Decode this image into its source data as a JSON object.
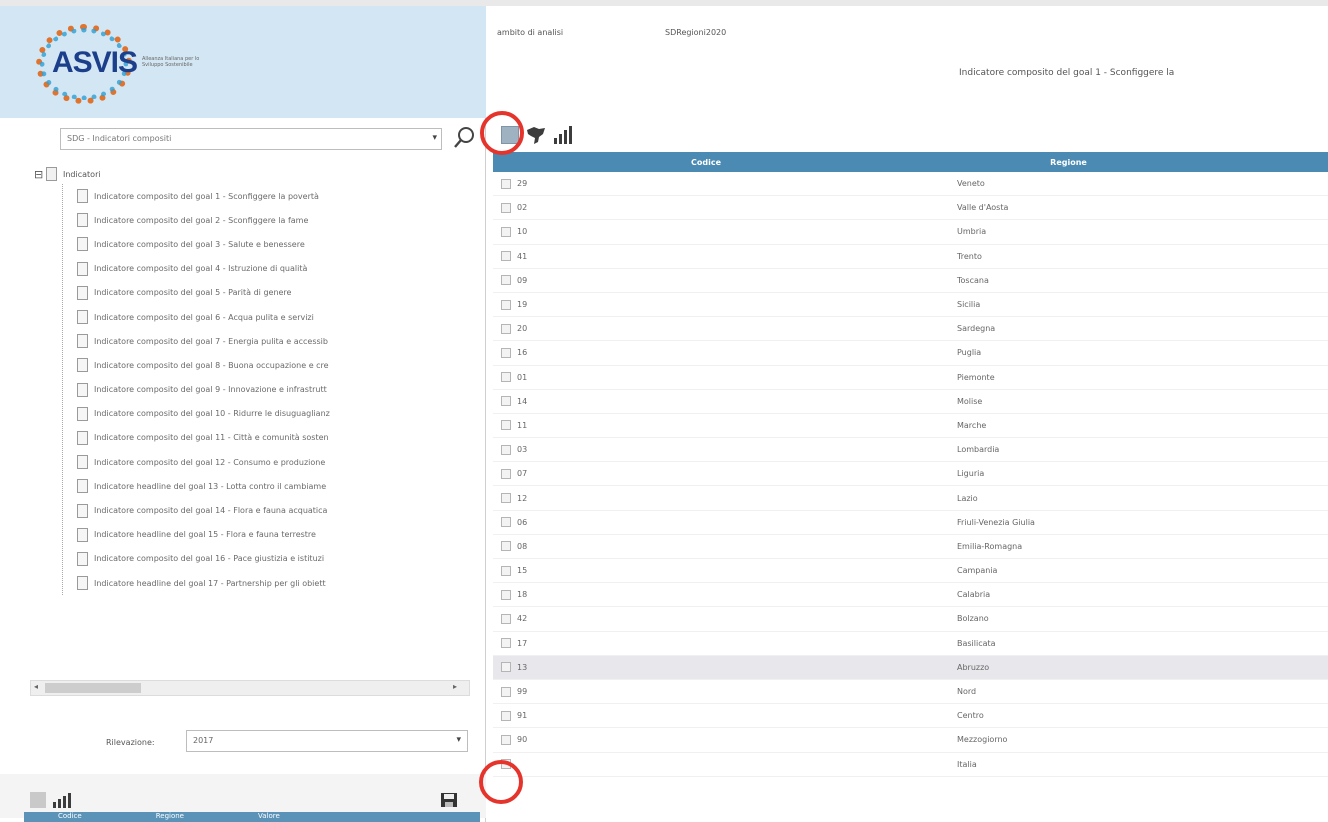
{
  "left": {
    "logo": {
      "text": "ASVIS",
      "subtitle": "Alleanza Italiana per lo Sviluppo Sostenibile"
    },
    "combo": {
      "value": "SDG - Indicatori compositi"
    },
    "tree": {
      "root_label": "Indicatori",
      "items": [
        "Indicatore composito del goal 1 - Sconfiggere la povertà",
        "Indicatore composito del goal 2 - Sconfiggere la fame",
        "Indicatore composito del goal 3 - Salute e benessere",
        "Indicatore composito del goal 4 - Istruzione di qualità",
        "Indicatore composito del goal 5 - Parità di genere",
        "Indicatore composito del goal 6 - Acqua pulita e servizi",
        "Indicatore composito del goal 7 - Energia pulita e accessib",
        "Indicatore composito del goal 8 - Buona occupazione e cre",
        "Indicatore composito del goal 9 - Innovazione e infrastrutt",
        "Indicatore composito del goal 10 - Ridurre le disuguaglianz",
        "Indicatore composito del goal 11 - Città e comunità sosten",
        "Indicatore composito del goal 12 - Consumo e produzione",
        "Indicatore headline del goal 13 - Lotta contro il cambiame",
        "Indicatore composito del goal 14 - Flora e fauna acquatica",
        "Indicatore headline del goal 15 - Flora e fauna terrestre",
        "Indicatore composito del goal 16 - Pace giustizia e istituzi",
        "Indicatore headline del goal 17 - Partnership per gli obiett"
      ]
    },
    "detection": {
      "label": "Rilevazione:",
      "value": "2017"
    },
    "bottom_grid": {
      "headers": [
        "Codice",
        "Regione",
        "Valore"
      ]
    }
  },
  "right": {
    "filter_label": "ambito di analisi",
    "filter_value": "SDRegioni2020",
    "indicator_title": "Indicatore composito del goal 1 - Sconfiggere la",
    "grid": {
      "headers": {
        "code": "Codice",
        "region": "Regione"
      },
      "rows": [
        {
          "code": "29",
          "region": "Veneto"
        },
        {
          "code": "02",
          "region": "Valle d'Aosta"
        },
        {
          "code": "10",
          "region": "Umbria"
        },
        {
          "code": "41",
          "region": "Trento"
        },
        {
          "code": "09",
          "region": "Toscana"
        },
        {
          "code": "19",
          "region": "Sicilia"
        },
        {
          "code": "20",
          "region": "Sardegna"
        },
        {
          "code": "16",
          "region": "Puglia"
        },
        {
          "code": "01",
          "region": "Piemonte"
        },
        {
          "code": "14",
          "region": "Molise"
        },
        {
          "code": "11",
          "region": "Marche"
        },
        {
          "code": "03",
          "region": "Lombardia"
        },
        {
          "code": "07",
          "region": "Liguria"
        },
        {
          "code": "12",
          "region": "Lazio"
        },
        {
          "code": "06",
          "region": "Friuli-Venezia Giulia"
        },
        {
          "code": "08",
          "region": "Emilia-Romagna"
        },
        {
          "code": "15",
          "region": "Campania"
        },
        {
          "code": "18",
          "region": "Calabria"
        },
        {
          "code": "42",
          "region": "Bolzano"
        },
        {
          "code": "17",
          "region": "Basilicata"
        },
        {
          "code": "13",
          "region": "Abruzzo"
        },
        {
          "code": "99",
          "region": "Nord"
        },
        {
          "code": "91",
          "region": "Centro"
        },
        {
          "code": "90",
          "region": "Mezzogiorno"
        },
        {
          "code": "",
          "region": "Italia"
        }
      ]
    }
  }
}
